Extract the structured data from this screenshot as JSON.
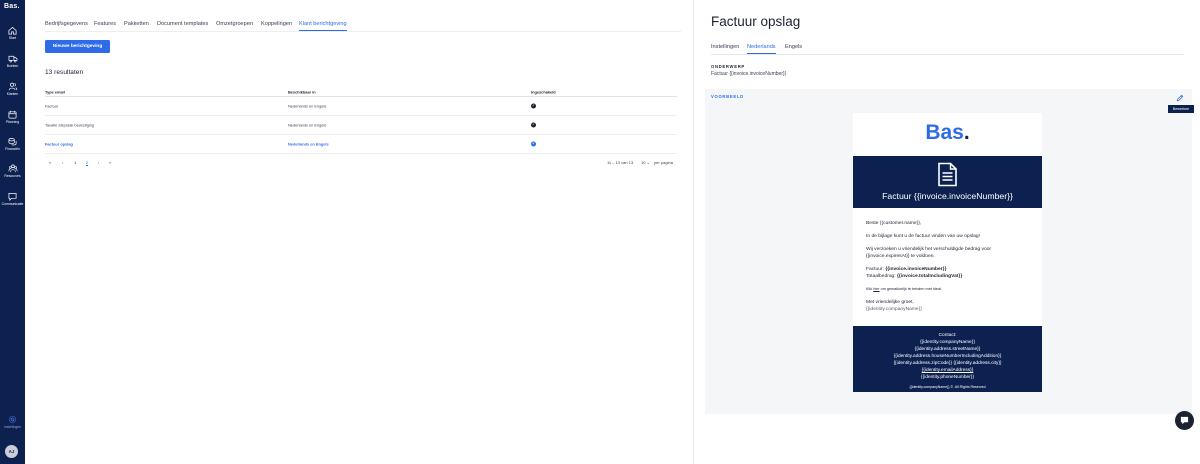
{
  "sidebar": {
    "logo": "Bas.",
    "items": [
      {
        "label": "Start",
        "icon": "home-icon"
      },
      {
        "label": "Boeken",
        "icon": "truck-icon"
      },
      {
        "label": "Klanten",
        "icon": "users-icon"
      },
      {
        "label": "Planning",
        "icon": "calendar-icon"
      },
      {
        "label": "Financiën",
        "icon": "coins-icon"
      },
      {
        "label": "Resources",
        "icon": "resources-icon"
      },
      {
        "label": "Communicatie",
        "icon": "chat-icon"
      }
    ],
    "settings_label": "Instellingen",
    "avatar_initials": "AJ"
  },
  "main": {
    "tabs": [
      {
        "label": "Bedrijfsgegevens"
      },
      {
        "label": "Features"
      },
      {
        "label": "Pakketten"
      },
      {
        "label": "Document templates"
      },
      {
        "label": "Omzetgroepen"
      },
      {
        "label": "Koppelingen"
      },
      {
        "label": "Klant berichtgeving",
        "active": true
      }
    ],
    "new_button": "Nieuwe berichtgeving",
    "results": "13 resultaten",
    "table": {
      "headers": [
        "Type email",
        "Beschikbaar in",
        "Ingeschakeld"
      ],
      "rows": [
        {
          "type": "Factuur",
          "available": "Nederlands en Engels",
          "enabled": true
        },
        {
          "type": "Taxatie afspraak bevestiging",
          "available": "Nederlands en Engels",
          "enabled": true
        },
        {
          "type": "Factuur opslag",
          "available": "Nederlands en Engels",
          "enabled": true,
          "selected": true
        }
      ]
    },
    "pagination": {
      "first": "«",
      "prev": "‹",
      "pages": [
        "1",
        "2"
      ],
      "current": "2",
      "next": "›",
      "last": "»",
      "range": "11 – 13 van 13",
      "per_page_value": "10",
      "per_page_label": "per pagina"
    }
  },
  "panel": {
    "title": "Factuur opslag",
    "tabs": [
      {
        "label": "Instellingen"
      },
      {
        "label": "Nederlands",
        "active": true
      },
      {
        "label": "Engels"
      }
    ],
    "subject_label": "ONDERWERP",
    "subject_value": "Factuur {{invoice.invoiceNumber}}",
    "preview_label": "VOORBEELD",
    "edit_button": "Bewerken",
    "email": {
      "logo_text": "Bas",
      "logo_dot": ".",
      "banner_title": "Factuur {{invoice.invoiceNumber}}",
      "greeting": "Beste {{customer.name}},",
      "line1": "In de bijlage kunt u de factuur vinden van uw opslag!",
      "line2": "Wij verzoeken u vriendelijk het verschuldigde bedrag voor {{invoice.expiresAt}} te voldoen.",
      "invoice_label": "Factuur:",
      "invoice_value": "{{invoice.invoiceNumber}}",
      "total_label": "Totaalbedrag:",
      "total_value": "{{invoice.totalIncludingVat}}",
      "pay_prefix": "Klik",
      "pay_link": "hier",
      "pay_suffix": "om gemakkelijk te betalen met ideal.",
      "closing": "Met vriendelijke groet,",
      "company": "{{identity.companyName}}",
      "footer": {
        "contact": "Contact:",
        "company": "{{identity.companyName}}",
        "street": "{{identity.address.streetName}}",
        "house": "{{identity.address.houseNumberIncludingAddition}}",
        "zip_city": "{{identity.address.zipCode}} {{identity.address.city}}",
        "email": "{{identity.emailAddress}}",
        "phone": "{{identity.phoneNumber}}",
        "rights": "{{identity.companyName}} ©. All Rights Reserved"
      }
    }
  },
  "colors": {
    "navy": "#0d2151",
    "accent": "#2e6be6"
  }
}
